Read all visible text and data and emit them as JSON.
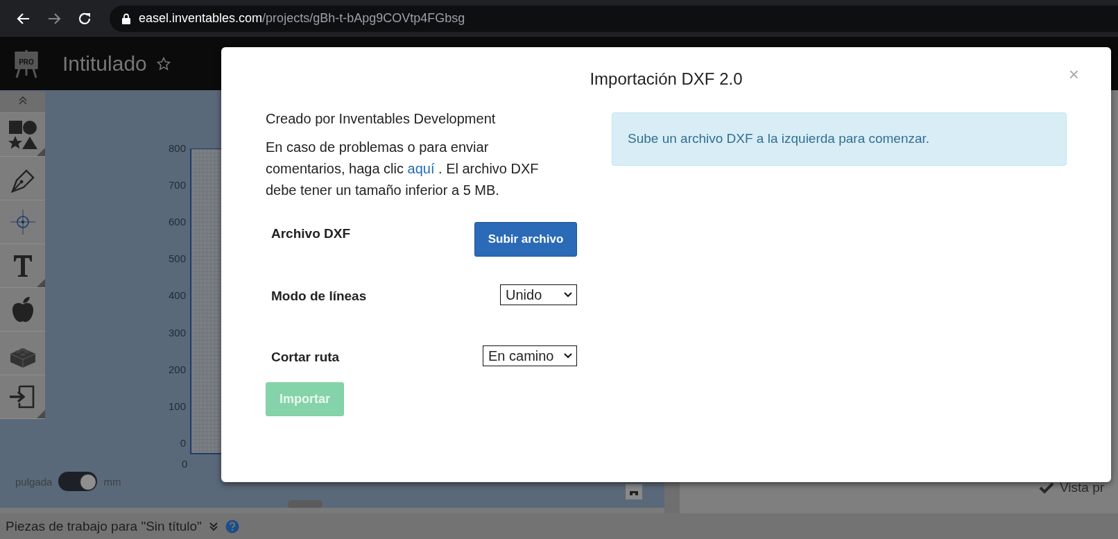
{
  "browser": {
    "back_enabled": true,
    "forward_enabled": false,
    "url_host": "easel.inventables.com",
    "url_path": "/projects/gBh-t-bApg9COVtp4FGbsg"
  },
  "header": {
    "logo_text": "PRO",
    "project_title": "Intitulado"
  },
  "canvas": {
    "y_axis_labels": [
      "800",
      "700",
      "600",
      "500",
      "400",
      "300",
      "200",
      "100",
      "0"
    ],
    "x_axis_labels": [
      "0"
    ],
    "unit_toggle": {
      "left_label": "pulgada",
      "right_label": "mm",
      "on": true
    }
  },
  "preview_option": {
    "label": "Vista pr",
    "checked": true
  },
  "bottom_bar": {
    "label": "Piezas de trabajo para \"Sin título\""
  },
  "dialog": {
    "title": "Importación DXF 2.0",
    "close_label": "×",
    "author": "Creado por Inventables Development",
    "help_before": "En caso de problemas o para enviar comentarios, haga clic ",
    "help_link": "aquí",
    "help_after": " . El archivo DXF debe tener un tamaño inferior a 5 MB.",
    "file_label": "Archivo DXF",
    "upload_button": "Subir archivo",
    "line_mode_label": "Modo de líneas",
    "line_mode_value": "Unido",
    "cut_path_label": "Cortar ruta",
    "cut_path_value": "En camino",
    "import_button": {
      "label": "Importar",
      "disabled": true
    },
    "notice": "Sube un archivo DXF a la izquierda para comenzar."
  }
}
